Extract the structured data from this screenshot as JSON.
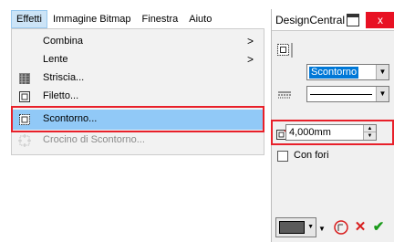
{
  "menubar": {
    "items": [
      {
        "label": "Effetti"
      },
      {
        "label": "Immagine Bitmap"
      },
      {
        "label": "Finestra"
      },
      {
        "label": "Aiuto"
      }
    ]
  },
  "effetti_menu": {
    "items": [
      {
        "label": "Combina",
        "submenu_arrow": ">"
      },
      {
        "label": "Lente",
        "submenu_arrow": ">"
      },
      {
        "label": "Striscia..."
      },
      {
        "label": "Filetto..."
      },
      {
        "label": "Scontorno...",
        "state": "selected"
      },
      {
        "label": "Crocino di Scontorno...",
        "state": "disabled"
      }
    ]
  },
  "panel": {
    "title": "DesignCentral",
    "close_glyph": "x",
    "mode_combo": {
      "value": "Scontorno"
    },
    "distance": {
      "value": "4,000mm"
    },
    "holes_checkbox": {
      "label": "Con fori",
      "checked": false
    }
  },
  "colors": {
    "highlight_box": "#e8202a",
    "selection": "#91c9f7",
    "apply_check": "#1a9a1a",
    "cancel_x": "#d81e1e"
  }
}
